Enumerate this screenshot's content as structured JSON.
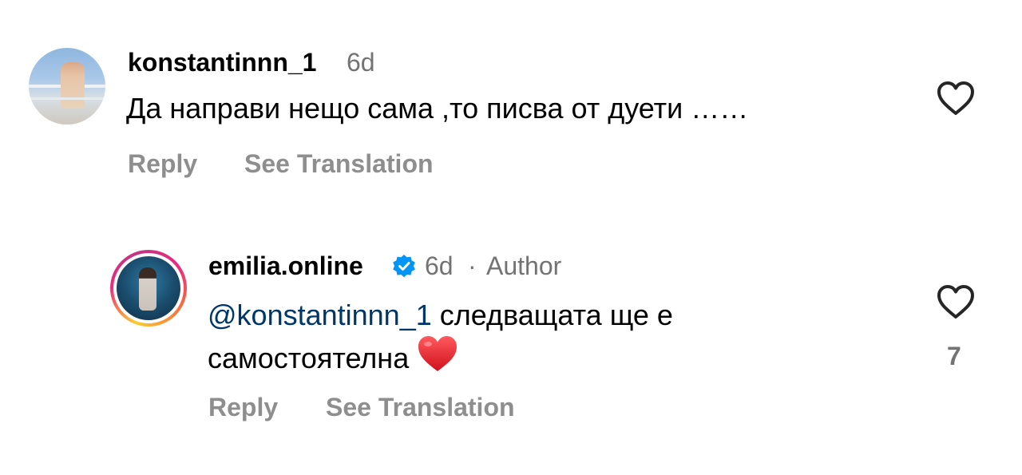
{
  "comments": [
    {
      "username": "konstantinnn_1",
      "time": "6d",
      "text": "Да направи нещо сама ,то писва от дуети ……",
      "reply_label": "Reply",
      "translate_label": "See Translation"
    },
    {
      "username": "emilia.online",
      "time": "6d",
      "separator": "·",
      "author_label": "Author",
      "mention": "@konstantinnn_1",
      "text_line1": " следващата ще е",
      "text_line2": "самостоятелна",
      "like_count": "7",
      "reply_label": "Reply",
      "translate_label": "See Translation"
    }
  ],
  "colors": {
    "mention": "#00376b",
    "verified": "#0095f6",
    "secondary_text": "#737373",
    "action_text": "#8e8e8e"
  },
  "icons": {
    "like": "heart-outline-icon",
    "verified": "verified-badge-icon",
    "emoji": "red-heart-emoji"
  }
}
